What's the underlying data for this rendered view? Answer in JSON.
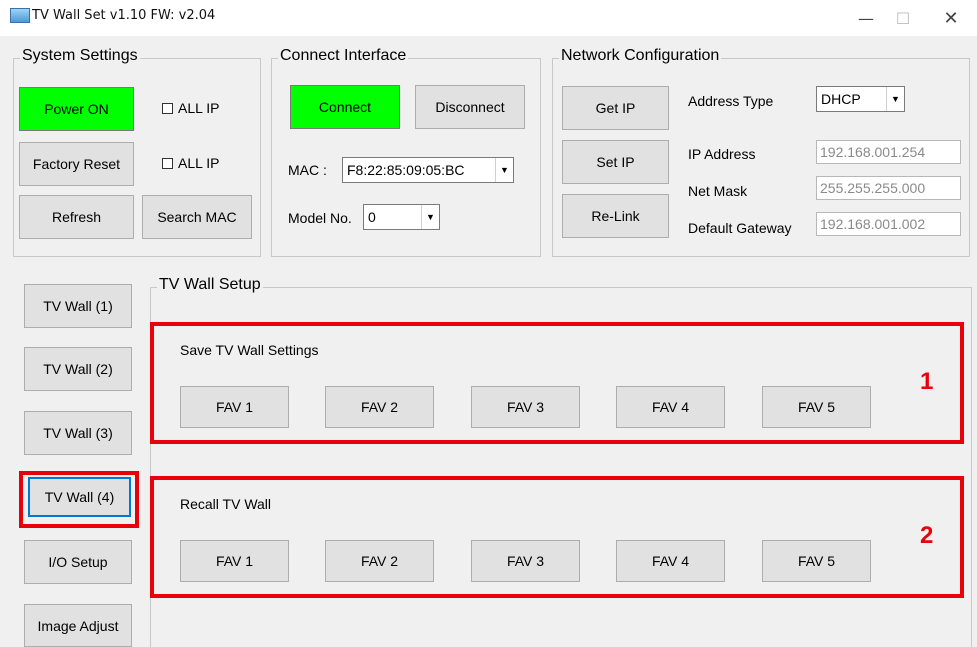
{
  "titlebar": {
    "title": "TV Wall Set v1.10   FW: v2.04",
    "minimize": "—",
    "maximize": "☐",
    "close": "✕"
  },
  "system_settings": {
    "title": "System Settings",
    "power_on": "Power ON",
    "factory_reset": "Factory Reset",
    "refresh": "Refresh",
    "search_mac": "Search MAC",
    "all_ip_1": "ALL IP",
    "all_ip_2": "ALL IP"
  },
  "connect_interface": {
    "title": "Connect Interface",
    "connect": "Connect",
    "disconnect": "Disconnect",
    "mac_label": "MAC :",
    "mac_value": "F8:22:85:09:05:BC",
    "model_label": "Model No.",
    "model_value": "0"
  },
  "network": {
    "title": "Network Configuration",
    "get_ip": "Get IP",
    "set_ip": "Set IP",
    "relink": "Re-Link",
    "address_type_label": "Address Type",
    "address_type_value": "DHCP",
    "ip_label": "IP Address",
    "ip_value": "192.168.001.254",
    "mask_label": "Net Mask",
    "mask_value": "255.255.255.000",
    "gateway_label": "Default Gateway",
    "gateway_value": "192.168.001.002"
  },
  "sidebar": {
    "items": [
      {
        "label": "TV Wall (1)"
      },
      {
        "label": "TV Wall (2)"
      },
      {
        "label": "TV Wall (3)"
      },
      {
        "label": "TV Wall (4)"
      },
      {
        "label": "I/O Setup"
      },
      {
        "label": "Image Adjust"
      }
    ]
  },
  "tv_wall_setup": {
    "title": "TV Wall Setup",
    "save_label": "Save TV Wall Settings",
    "recall_label": "Recall TV Wall",
    "save_buttons": [
      "FAV 1",
      "FAV 2",
      "FAV 3",
      "FAV 4",
      "FAV 5"
    ],
    "recall_buttons": [
      "FAV 1",
      "FAV 2",
      "FAV 3",
      "FAV 4",
      "FAV 5"
    ]
  },
  "annotations": {
    "num1": "1",
    "num2": "2",
    "highlight_color": "#e8000b"
  },
  "colors": {
    "green_button": "#00ff00",
    "focus_blue": "#0078d7"
  }
}
